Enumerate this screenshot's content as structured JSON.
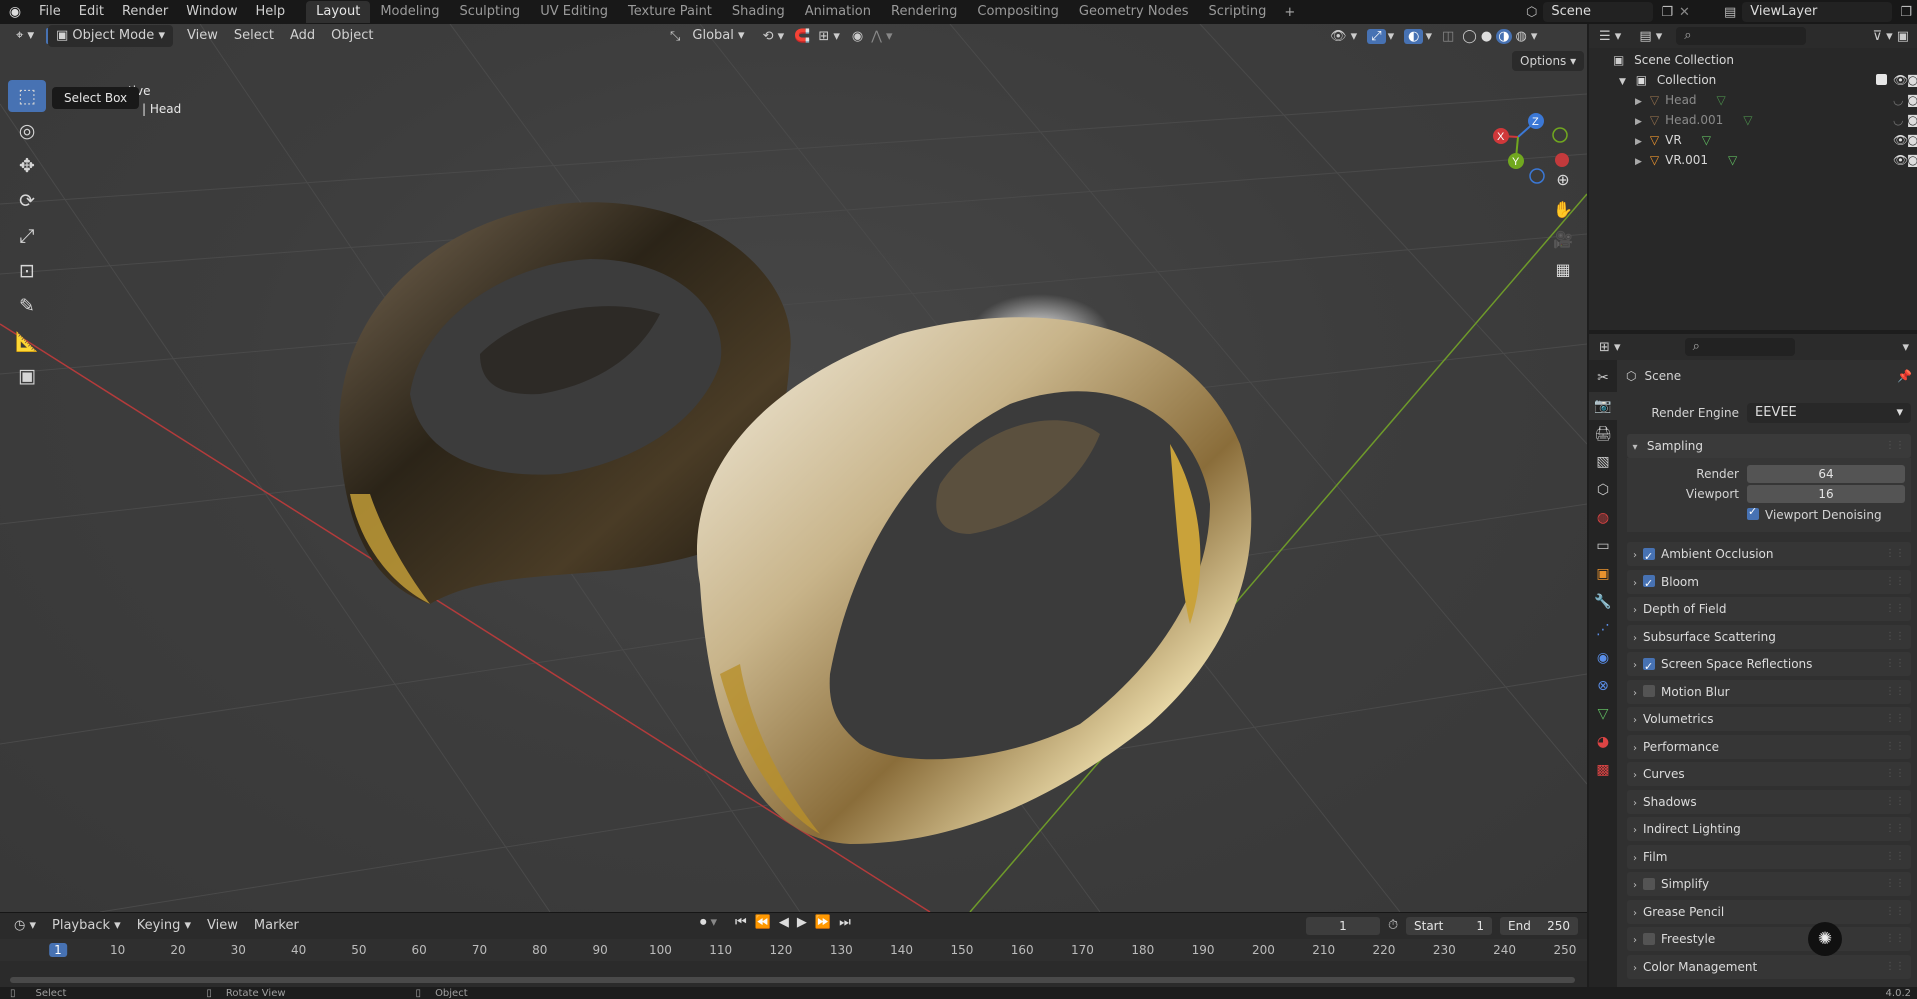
{
  "topbar": {
    "menus": [
      "File",
      "Edit",
      "Render",
      "Window",
      "Help"
    ],
    "workspaces": [
      "Layout",
      "Modeling",
      "Sculpting",
      "UV Editing",
      "Texture Paint",
      "Shading",
      "Animation",
      "Rendering",
      "Compositing",
      "Geometry Nodes",
      "Scripting"
    ],
    "active_workspace": "Layout",
    "add_tab": "+",
    "scene": "Scene",
    "view_layer": "ViewLayer"
  },
  "viewport_header": {
    "mode": "Object Mode",
    "menus": [
      "View",
      "Select",
      "Add",
      "Object"
    ],
    "transform_orientation": "Global",
    "options": "Options"
  },
  "viewport": {
    "tooltip": "Select Box",
    "overlay_line1": "tive",
    "overlay_line2": "| Head",
    "gizmo_axes": {
      "x": "X",
      "y": "Y",
      "z": "Z"
    },
    "grid_colors": {
      "x_axis": "#b33b3b",
      "y_axis": "#6e9a2a"
    }
  },
  "timeline": {
    "menus": [
      "Playback",
      "Keying",
      "View",
      "Marker"
    ],
    "current_frame": "1",
    "start_label": "Start",
    "start_value": "1",
    "end_label": "End",
    "end_value": "250",
    "ruler": [
      "1",
      "10",
      "20",
      "30",
      "40",
      "50",
      "60",
      "70",
      "80",
      "90",
      "100",
      "110",
      "120",
      "130",
      "140",
      "150",
      "160",
      "170",
      "180",
      "190",
      "200",
      "210",
      "220",
      "230",
      "240",
      "250"
    ]
  },
  "statusbar": {
    "items": [
      "Select",
      "Rotate View",
      "Object"
    ],
    "version": "4.0.2"
  },
  "outliner": {
    "root": "Scene Collection",
    "collection": "Collection",
    "objects": [
      {
        "name": "Head",
        "dim": true
      },
      {
        "name": "Head.001",
        "dim": true
      },
      {
        "name": "VR",
        "dim": false
      },
      {
        "name": "VR.001",
        "dim": false
      }
    ]
  },
  "properties": {
    "context": "Scene",
    "render_engine_label": "Render Engine",
    "render_engine": "EEVEE",
    "sampling": {
      "title": "Sampling",
      "render_label": "Render",
      "render_value": "64",
      "viewport_label": "Viewport",
      "viewport_value": "16",
      "denoise_label": "Viewport Denoising"
    },
    "panels": [
      {
        "label": "Ambient Occlusion",
        "checkbox": true,
        "checked": true
      },
      {
        "label": "Bloom",
        "checkbox": true,
        "checked": true
      },
      {
        "label": "Depth of Field",
        "checkbox": false,
        "checked": false
      },
      {
        "label": "Subsurface Scattering",
        "checkbox": false,
        "checked": false
      },
      {
        "label": "Screen Space Reflections",
        "checkbox": true,
        "checked": true
      },
      {
        "label": "Motion Blur",
        "checkbox": true,
        "checked": false
      },
      {
        "label": "Volumetrics",
        "checkbox": false,
        "checked": false
      },
      {
        "label": "Performance",
        "checkbox": false,
        "checked": false
      },
      {
        "label": "Curves",
        "checkbox": false,
        "checked": false
      },
      {
        "label": "Shadows",
        "checkbox": false,
        "checked": false
      },
      {
        "label": "Indirect Lighting",
        "checkbox": false,
        "checked": false
      },
      {
        "label": "Film",
        "checkbox": false,
        "checked": false
      },
      {
        "label": "Simplify",
        "checkbox": true,
        "checked": false
      },
      {
        "label": "Grease Pencil",
        "checkbox": false,
        "checked": false
      },
      {
        "label": "Freestyle",
        "checkbox": true,
        "checked": false
      },
      {
        "label": "Color Management",
        "checkbox": false,
        "checked": false
      }
    ]
  },
  "colors": {
    "accent": "#4772b3",
    "object_orange": "#e8922e",
    "mesh_green": "#5fb85f"
  }
}
